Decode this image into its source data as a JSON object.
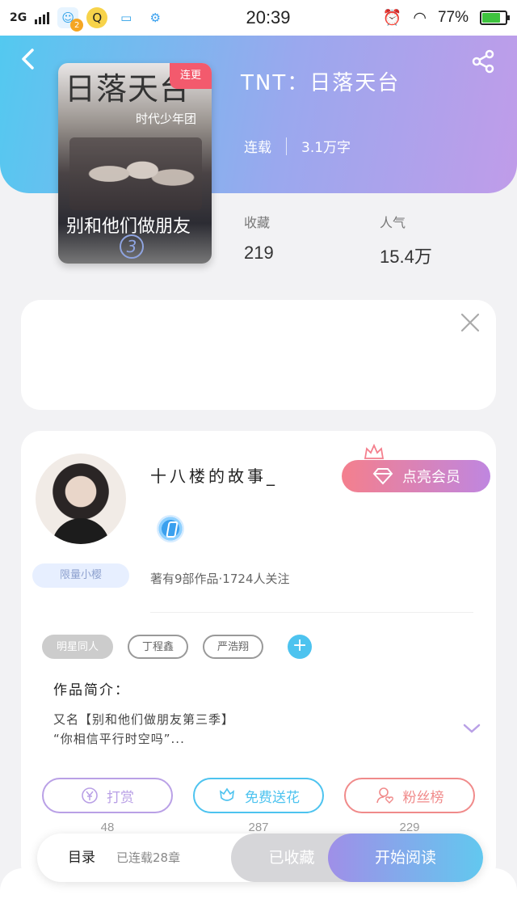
{
  "status_bar": {
    "network": "2G",
    "notification_count": "2",
    "time": "20:39",
    "battery_percent": "77%",
    "battery_level": 0.77
  },
  "book": {
    "title": "TNT：日落天台",
    "status": "连载",
    "word_count": "3.1万字",
    "cover": {
      "title_line": "日落天台",
      "subtitle": "时代少年团",
      "main_text": "别和他们做朋友",
      "volume": "3",
      "tag": "连更"
    },
    "stats": [
      {
        "label": "收藏",
        "value": "219"
      },
      {
        "label": "人气",
        "value": "15.4万"
      }
    ]
  },
  "author": {
    "name": "十八楼的故事_",
    "vip_label": "点亮会员",
    "fan_tag": "限量小樱",
    "meta": "著有9部作品·1724人关注"
  },
  "tags": [
    "明星同人",
    "丁程鑫",
    "严浩翔"
  ],
  "intro": {
    "label": "作品简介：",
    "line1": "又名【别和他们做朋友第三季】",
    "line2": "“你相信平行时空吗”..."
  },
  "actions": [
    {
      "label": "打赏",
      "count": "48",
      "color": "#b9a0e6"
    },
    {
      "label": "免费送花",
      "count": "287",
      "color": "#4dc3ef"
    },
    {
      "label": "粉丝榜",
      "count": "229",
      "color": "#f08a8a"
    }
  ],
  "bottom_bar": {
    "toc_label": "目录",
    "toc_sub": "已连载28章",
    "collected_label": "已收藏",
    "read_label": "开始阅读"
  }
}
